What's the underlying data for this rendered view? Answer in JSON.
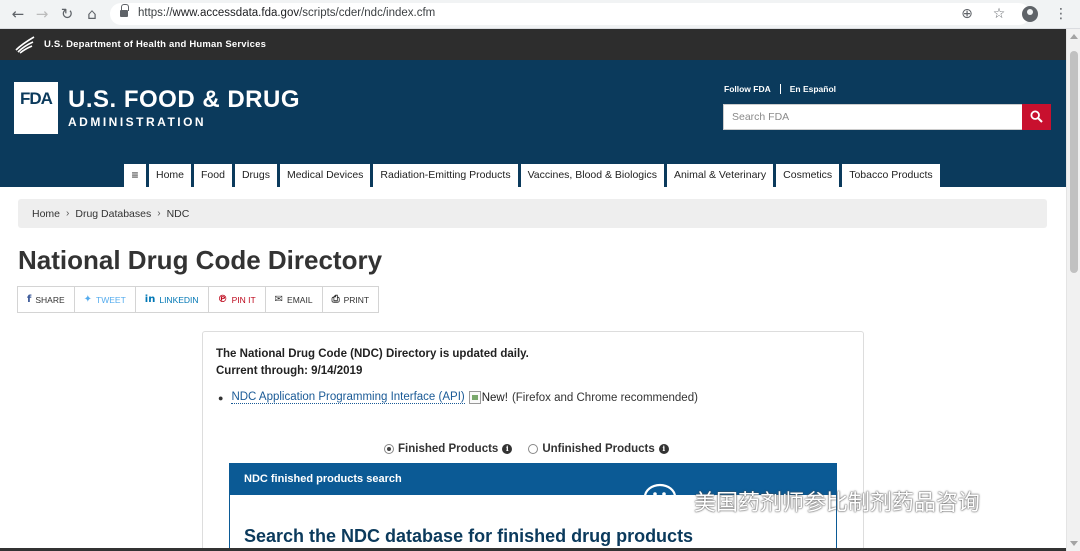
{
  "browser": {
    "url_scheme": "https://",
    "url_host": "www.accessdata.fda.gov",
    "url_path": "/scripts/cder/ndc/index.cfm",
    "icons": [
      "back-icon",
      "forward-icon",
      "reload-icon",
      "home-icon",
      "lock-icon",
      "zoom-icon",
      "star-icon",
      "profile-icon",
      "menu-icon"
    ]
  },
  "gov_bar": {
    "text": "U.S. Department of Health and Human Services"
  },
  "header": {
    "logo": "FDA",
    "title": "U.S. FOOD & DRUG",
    "subtitle": "ADMINISTRATION",
    "follow": "Follow FDA",
    "espanol": "En Español",
    "search_placeholder": "Search FDA"
  },
  "nav": {
    "menu_glyph": "≡",
    "items": [
      "Home",
      "Food",
      "Drugs",
      "Medical Devices",
      "Radiation-Emitting Products",
      "Vaccines, Blood & Biologics",
      "Animal & Veterinary",
      "Cosmetics",
      "Tobacco Products"
    ]
  },
  "breadcrumb": [
    "Home",
    "Drug Databases",
    "NDC"
  ],
  "page_title": "National Drug Code Directory",
  "share": {
    "share": "SHARE",
    "tweet": "TWEET",
    "linkedin": "LINKEDIN",
    "pinit": "PIN IT",
    "email": "EMAIL",
    "print": "PRINT"
  },
  "notice": {
    "line1": "The National Drug Code (NDC) Directory is updated daily.",
    "line2": "Current through: 9/14/2019"
  },
  "api": {
    "link": "NDC Application Programming Interface (API)",
    "new_alt": "New!",
    "tail": "(Firefox and Chrome recommended)"
  },
  "radios": {
    "finished": "Finished Products",
    "unfinished": "Unfinished Products",
    "selected": "finished"
  },
  "search_card": {
    "header": "NDC finished products search",
    "title": "Search the NDC database for finished drug products"
  },
  "watermark": {
    "text": "美国药剂师参比制剂药品咨询"
  },
  "colors": {
    "header_bg": "#0b3a5c",
    "gov_bar_bg": "#2d2d2d",
    "search_btn": "#c8102e",
    "card_head": "#0b5a95"
  }
}
